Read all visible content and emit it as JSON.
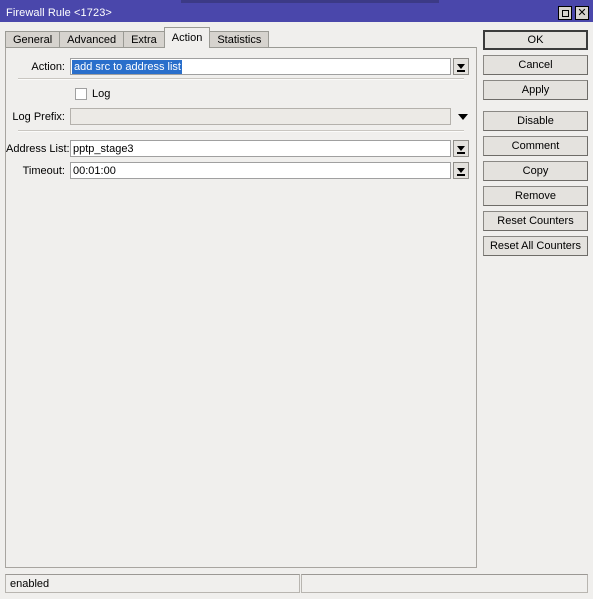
{
  "window": {
    "title": "Firewall Rule <1723>",
    "controls": {
      "restore_label": "",
      "close_label": "✕"
    }
  },
  "tabs": [
    {
      "label": "General",
      "active": false
    },
    {
      "label": "Advanced",
      "active": false
    },
    {
      "label": "Extra",
      "active": false
    },
    {
      "label": "Action",
      "active": true
    },
    {
      "label": "Statistics",
      "active": false
    }
  ],
  "form": {
    "action": {
      "label": "Action:",
      "value": "add src to address list",
      "selected": true
    },
    "log": {
      "label": "Log",
      "checked": false
    },
    "log_prefix": {
      "label": "Log Prefix:",
      "value": "",
      "placeholder": "",
      "disabled": true
    },
    "address_list": {
      "label": "Address List:",
      "value": "pptp_stage3"
    },
    "timeout": {
      "label": "Timeout:",
      "value": "00:01:00"
    }
  },
  "buttons": [
    {
      "label": "OK",
      "default": true
    },
    {
      "label": "Cancel",
      "default": false
    },
    {
      "label": "Apply",
      "default": false
    },
    {
      "label": "Disable",
      "default": false
    },
    {
      "label": "Comment",
      "default": false
    },
    {
      "label": "Copy",
      "default": false
    },
    {
      "label": "Remove",
      "default": false
    },
    {
      "label": "Reset Counters",
      "default": false
    },
    {
      "label": "Reset All Counters",
      "default": false
    }
  ],
  "statusbar": {
    "state": "enabled",
    "extra": ""
  }
}
